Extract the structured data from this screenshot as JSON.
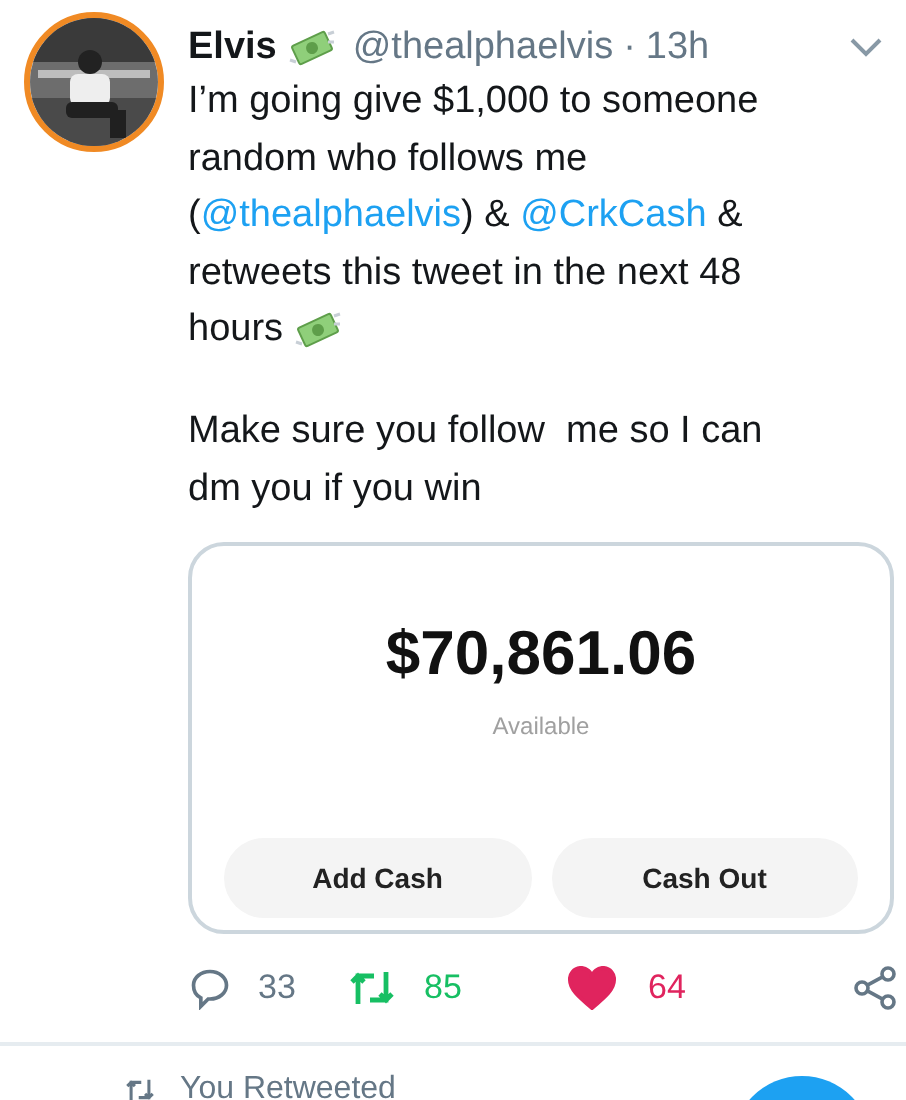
{
  "tweet": {
    "name": "Elvis",
    "handle": "@thealphaelvis",
    "separator": "·",
    "time": "13h",
    "paragraphs": [
      [
        [
          {
            "kind": "text",
            "text": "I’m going give $1,000 to someone"
          }
        ],
        [
          {
            "kind": "text",
            "text": "random who follows me"
          }
        ],
        [
          {
            "kind": "text",
            "text": "("
          },
          {
            "kind": "mention",
            "text": "@thealphaelvis"
          },
          {
            "kind": "text",
            "text": ") & "
          },
          {
            "kind": "mention",
            "text": "@CrkCash"
          },
          {
            "kind": "text",
            "text": " &"
          }
        ],
        [
          {
            "kind": "text",
            "text": "retweets this tweet in the next 48"
          }
        ],
        [
          {
            "kind": "text",
            "text": "hours "
          },
          {
            "kind": "emoji"
          }
        ]
      ],
      [
        [
          {
            "kind": "text",
            "text": "Make sure you follow  me so I can"
          }
        ],
        [
          {
            "kind": "text",
            "text": "dm you if you win"
          }
        ]
      ]
    ],
    "card": {
      "amount": "$70,861.06",
      "caption": "Available",
      "buttons": [
        "Add Cash",
        "Cash Out"
      ]
    },
    "actions": {
      "replies": "33",
      "retweets": "85",
      "retweeted": true,
      "likes": "64",
      "liked": true
    }
  },
  "next": {
    "context": "You Retweeted"
  }
}
